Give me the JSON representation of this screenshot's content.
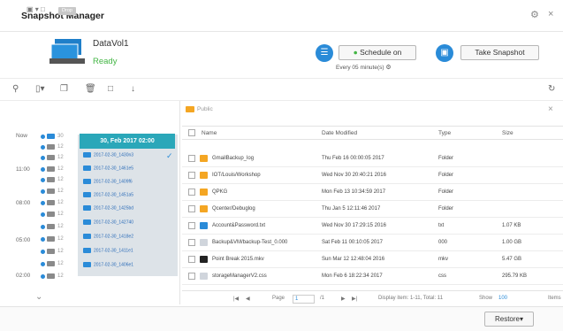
{
  "window": {
    "title": "Snapshot Manager"
  },
  "volume": {
    "name": "DataVol1",
    "status": "Ready"
  },
  "schedule": {
    "button_label": "Schedule on",
    "subtitle": "Every 05 minute(s)"
  },
  "take_snapshot": {
    "label": "Take Snapshot"
  },
  "left_panel": {
    "tag": "Drop",
    "time_labels": [
      "Now",
      "11:00",
      "08:00",
      "05:00",
      "02:00"
    ],
    "timeline_num": "12",
    "timeline_first_num": "30",
    "selected_snapshot": "30, Feb 2017 02:00",
    "snapshots": [
      "2017-02-30_1430n3",
      "2017-02-30_1461e5",
      "2017-02-30_1409f6",
      "2017-02-30_1451a5",
      "2017-02-30_1425bd",
      "2017-02-30_142740",
      "2017-02-30_1418e2",
      "2017-02-30_1411e1",
      "2017-02-30_1406e1"
    ]
  },
  "breadcrumb": {
    "folder": "Public"
  },
  "table": {
    "headers": {
      "name": "Name",
      "date": "Date Modified",
      "type": "Type",
      "size": "Size"
    },
    "rows": [
      {
        "icon": "folder-icon",
        "name": "GmailBackup_log",
        "date": "Thu Feb 16 00:00:05 2017",
        "type": "Folder",
        "size": ""
      },
      {
        "icon": "folder-icon",
        "name": "IOT/Louis/Workshop",
        "date": "Wed Nov 30 20:40:21 2016",
        "type": "Folder",
        "size": ""
      },
      {
        "icon": "folder-icon",
        "name": "QPKG",
        "date": "Mon Feb 13 10:34:59 2017",
        "type": "Folder",
        "size": ""
      },
      {
        "icon": "folder-icon",
        "name": "Qcenter/Debuglog",
        "date": "Thu Jan 5 12:11:46 2017",
        "type": "Folder",
        "size": ""
      },
      {
        "icon": "txt-file-icon",
        "name": "Account&Password.txt",
        "date": "Wed Nov 30 17:29:15 2016",
        "type": "txt",
        "size": "1.07 KB"
      },
      {
        "icon": "doc-file-icon",
        "name": "Backup&VM/backup-Test_0.000",
        "date": "Sat Feb 11 00:10:05 2017",
        "type": "000",
        "size": "1.00 GB"
      },
      {
        "icon": "video-file-icon",
        "name": "Point Break 2015.mkv",
        "date": "Sun Mar 12 12:48:04 2016",
        "type": "mkv",
        "size": "5.47 GB"
      },
      {
        "icon": "doc-file-icon",
        "name": "storageManagerV2.css",
        "date": "Mon Feb 6 18:22:34 2017",
        "type": "css",
        "size": "295.79 KB"
      }
    ]
  },
  "pager": {
    "page_label": "Page",
    "page_value": "1",
    "page_total": "/1",
    "display": "Display item: 1-11, Total: 11",
    "show_label": "Show",
    "show_value": "100",
    "items_label": "Items"
  },
  "footer": {
    "restore_label": "Restore"
  },
  "colors": {
    "accent": "#2a8bd8",
    "ready": "#42b543",
    "folder": "#f4a623",
    "snapshot_header": "#2aa7b9"
  }
}
